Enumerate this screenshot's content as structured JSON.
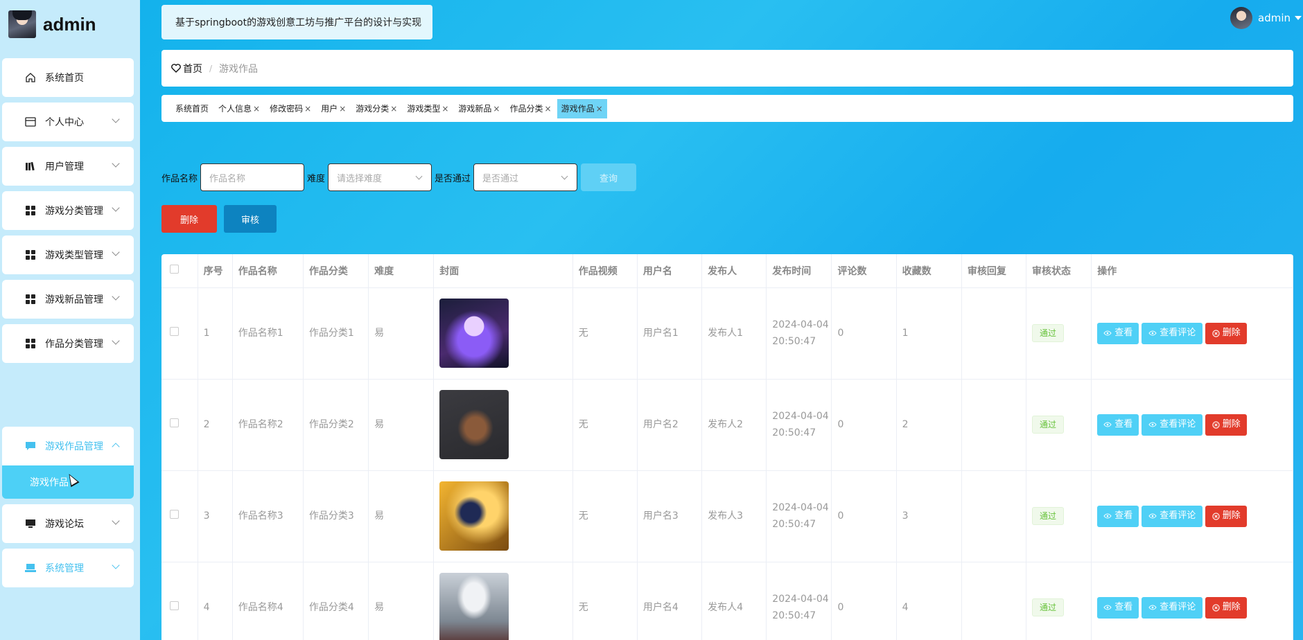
{
  "app": {
    "name": "admin"
  },
  "sidebar": {
    "items": [
      {
        "label": "系统首页",
        "icon": "home-icon"
      },
      {
        "label": "个人中心",
        "icon": "id-card-icon"
      },
      {
        "label": "用户管理",
        "icon": "users-icon"
      },
      {
        "label": "游戏分类管理",
        "icon": "grid-icon"
      },
      {
        "label": "游戏类型管理",
        "icon": "grid-icon"
      },
      {
        "label": "游戏新品管理",
        "icon": "grid-icon"
      },
      {
        "label": "作品分类管理",
        "icon": "grid-icon"
      },
      {
        "label": "游戏作品管理",
        "icon": "chat-icon"
      },
      {
        "label": "游戏论坛",
        "icon": "monitor-icon"
      },
      {
        "label": "系统管理",
        "icon": "laptop-icon"
      }
    ],
    "submenu_item": "游戏作品"
  },
  "header": {
    "site_title": "基于springboot的游戏创意工坊与推广平台的设计与实现",
    "user": "admin"
  },
  "breadcrumb": {
    "home": "首页",
    "separator": "/",
    "current": "游戏作品"
  },
  "tabs": [
    "系统首页",
    "个人信息",
    "修改密码",
    "用户",
    "游戏分类",
    "游戏类型",
    "游戏新品",
    "作品分类",
    "游戏作品"
  ],
  "tab_close": "×",
  "filter": {
    "name_label": "作品名称",
    "name_placeholder": "作品名称",
    "difficulty_label": "难度",
    "difficulty_placeholder": "请选择难度",
    "passed_label": "是否通过",
    "passed_placeholder": "是否通过",
    "query_button": "查询"
  },
  "actions": {
    "delete": "删除",
    "audit": "审核"
  },
  "table": {
    "headers": [
      "",
      "序号",
      "作品名称",
      "作品分类",
      "难度",
      "封面",
      "作品视频",
      "用户名",
      "发布人",
      "发布时间",
      "评论数",
      "收藏数",
      "审核回复",
      "审核状态",
      "操作"
    ],
    "rows": [
      {
        "index": "1",
        "name": "作品名称1",
        "category": "作品分类1",
        "difficulty": "易",
        "video": "无",
        "username": "用户名1",
        "publisher": "发布人1",
        "time": "2024-04-04 20:50:47",
        "comments": "0",
        "favorites": "1",
        "reply": "",
        "status": "通过"
      },
      {
        "index": "2",
        "name": "作品名称2",
        "category": "作品分类2",
        "difficulty": "易",
        "video": "无",
        "username": "用户名2",
        "publisher": "发布人2",
        "time": "2024-04-04 20:50:47",
        "comments": "0",
        "favorites": "2",
        "reply": "",
        "status": "通过"
      },
      {
        "index": "3",
        "name": "作品名称3",
        "category": "作品分类3",
        "difficulty": "易",
        "video": "无",
        "username": "用户名3",
        "publisher": "发布人3",
        "time": "2024-04-04 20:50:47",
        "comments": "0",
        "favorites": "3",
        "reply": "",
        "status": "通过"
      },
      {
        "index": "4",
        "name": "作品名称4",
        "category": "作品分类4",
        "difficulty": "易",
        "video": "无",
        "username": "用户名4",
        "publisher": "发布人4",
        "time": "2024-04-04 20:50:47",
        "comments": "0",
        "favorites": "4",
        "reply": "",
        "status": "通过"
      }
    ],
    "row_actions": {
      "view": "查看",
      "view_comments": "查看评论",
      "delete": "删除"
    }
  },
  "colors": {
    "primary": "#4fd0f6",
    "danger": "#e23b2b",
    "audit": "#0d83c0",
    "sidebar_bg": "#c5ebfb",
    "success": "#67c23a"
  }
}
